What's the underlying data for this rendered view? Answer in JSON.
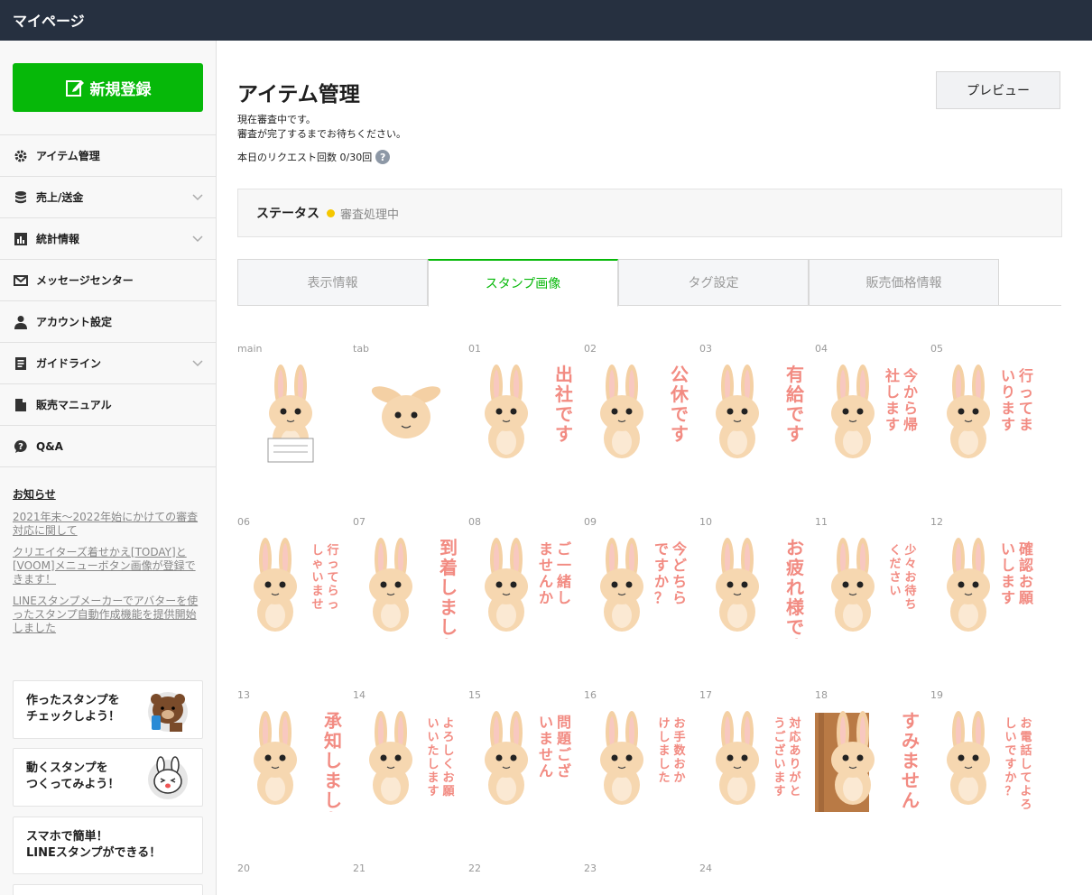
{
  "topbar": {
    "title": "マイページ"
  },
  "sidebar": {
    "new_button": "新規登録",
    "items": [
      {
        "label": "アイテム管理",
        "icon": "gear-icon",
        "expandable": false
      },
      {
        "label": "売上/送金",
        "icon": "coins-icon",
        "expandable": true
      },
      {
        "label": "統計情報",
        "icon": "chart-icon",
        "expandable": true
      },
      {
        "label": "メッセージセンター",
        "icon": "mail-icon",
        "expandable": false
      },
      {
        "label": "アカウント設定",
        "icon": "user-icon",
        "expandable": false
      },
      {
        "label": "ガイドライン",
        "icon": "document-icon",
        "expandable": true
      },
      {
        "label": "販売マニュアル",
        "icon": "file-icon",
        "expandable": false
      },
      {
        "label": "Q&A",
        "icon": "question-icon",
        "expandable": false
      }
    ],
    "news": {
      "heading": "お知らせ",
      "links": [
        "2021年末～2022年始にかけての審査対応に関して",
        "クリエイターズ着せかえ[TODAY]と[VOOM]メニューボタン画像が登録できます！",
        "LINEスタンプメーカーでアバターを使ったスタンプ自動作成機能を提供開始しました"
      ]
    },
    "promos": [
      {
        "line1": "作ったスタンプを",
        "line2": "チェックしよう！"
      },
      {
        "line1": "動くスタンプを",
        "line2": "つくってみよう！"
      },
      {
        "line1": "スマホで簡単！",
        "line2": "LINEスタンプができる！"
      }
    ]
  },
  "main": {
    "title": "アイテム管理",
    "preview_button": "プレビュー",
    "notice_line1": "現在審査中です。",
    "notice_line2": "審査が完了するまでお待ちください。",
    "request_count": "本日のリクエスト回数 0/30回",
    "status_label": "ステータス",
    "status_value": "審査処理中",
    "status_color": "#f5c700",
    "tabs": [
      "表示情報",
      "スタンプ画像",
      "タグ設定",
      "販売価格情報"
    ],
    "active_tab": "スタンプ画像",
    "stamps": [
      {
        "label": "main",
        "text": ""
      },
      {
        "label": "tab",
        "text": ""
      },
      {
        "label": "01",
        "text": "出社です"
      },
      {
        "label": "02",
        "text": "公休です"
      },
      {
        "label": "03",
        "text": "有給です"
      },
      {
        "label": "04",
        "text": "今から帰社します"
      },
      {
        "label": "05",
        "text": "行ってまいります"
      },
      {
        "label": "06",
        "text": "行ってらっしゃいませ"
      },
      {
        "label": "07",
        "text": "到着しました"
      },
      {
        "label": "08",
        "text": "ご一緒しませんか"
      },
      {
        "label": "09",
        "text": "今どちらですか？"
      },
      {
        "label": "10",
        "text": "お疲れ様です"
      },
      {
        "label": "11",
        "text": "少々お待ちください"
      },
      {
        "label": "12",
        "text": "確認お願いします"
      },
      {
        "label": "13",
        "text": "承知しました"
      },
      {
        "label": "14",
        "text": "よろしくお願いいたします"
      },
      {
        "label": "15",
        "text": "問題ございません"
      },
      {
        "label": "16",
        "text": "お手数おかけしました"
      },
      {
        "label": "17",
        "text": "対応ありがとうございます"
      },
      {
        "label": "18",
        "text": "すみません"
      },
      {
        "label": "19",
        "text": "お電話してよろしいですか？"
      },
      {
        "label": "20",
        "text": ""
      },
      {
        "label": "21",
        "text": ""
      },
      {
        "label": "22",
        "text": ""
      },
      {
        "label": "23",
        "text": ""
      },
      {
        "label": "24",
        "text": ""
      }
    ]
  }
}
